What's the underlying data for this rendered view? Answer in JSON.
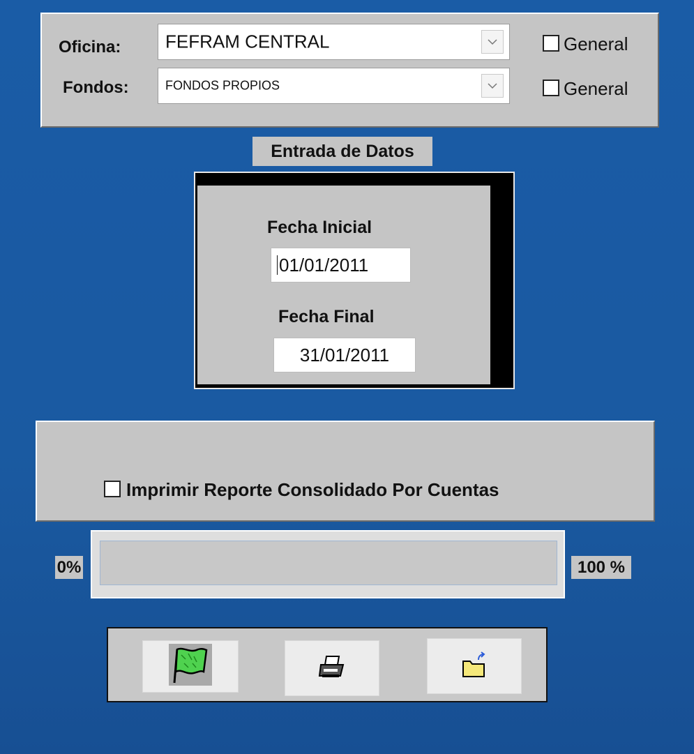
{
  "filters": {
    "oficina": {
      "label": "Oficina:",
      "value": "FEFRAM CENTRAL",
      "general_label": "General",
      "general_checked": false
    },
    "fondos": {
      "label": "Fondos:",
      "value": "FONDOS PROPIOS",
      "general_label": "General",
      "general_checked": false
    }
  },
  "entrada": {
    "title": "Entrada de Datos",
    "fecha_inicial_label": "Fecha Inicial",
    "fecha_inicial_value": "01/01/2011",
    "fecha_final_label": "Fecha Final",
    "fecha_final_value": "31/01/2011"
  },
  "options": {
    "consolidado_label": "Imprimir Reporte Consolidado Por Cuentas",
    "consolidado_checked": false
  },
  "progress": {
    "min_label": "0%",
    "max_label": "100 %",
    "value_percent": 0
  },
  "toolbar": {
    "buttons": [
      {
        "icon": "flag-icon"
      },
      {
        "icon": "printer-icon"
      },
      {
        "icon": "folder-exit-icon"
      }
    ]
  }
}
